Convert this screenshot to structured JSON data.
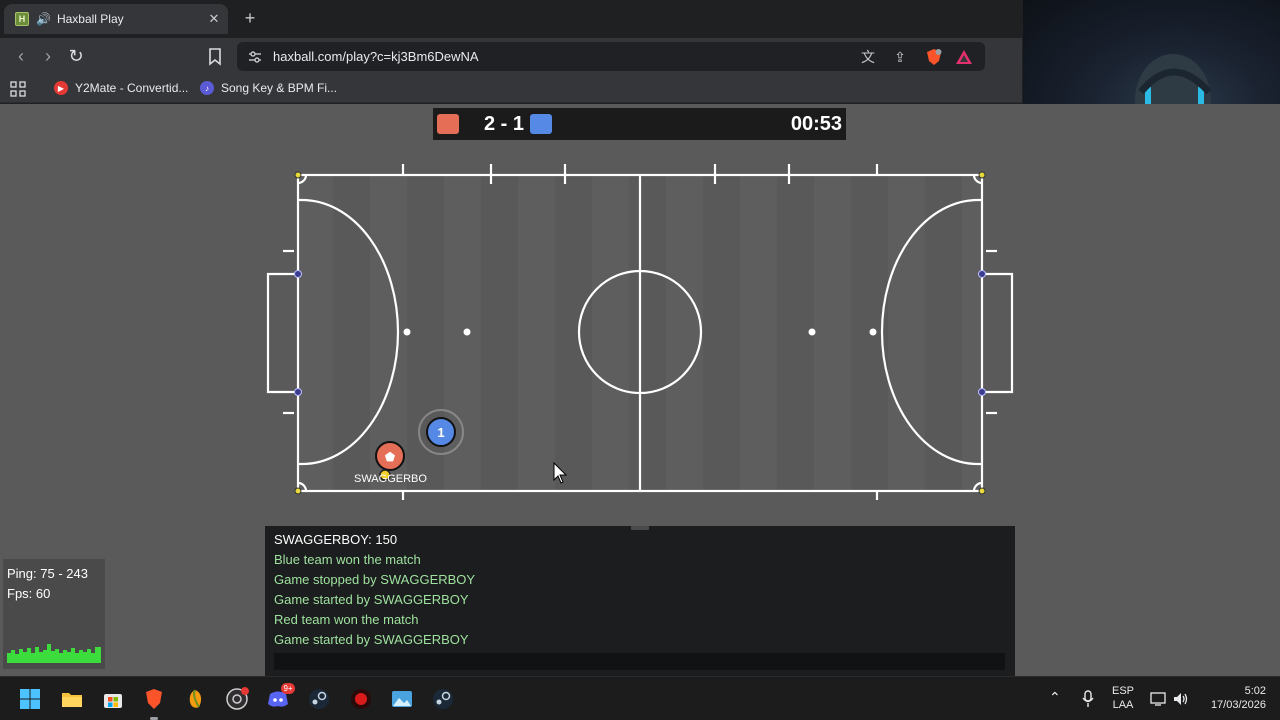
{
  "browser": {
    "tab": {
      "title": "Haxball Play",
      "favicon": "H",
      "icons": [
        "speaker-icon",
        "close-icon"
      ]
    },
    "new_tab_label": "+",
    "url": "haxball.com/play?c=kj3Bm6DewNA",
    "bookmarks": [
      {
        "label": "Y2Mate - Convertid...",
        "icon": "y2mate-icon",
        "color": "#e53935"
      },
      {
        "label": "Song Key & BPM Fi...",
        "icon": "song-key-icon",
        "color": "#5b5bd6"
      }
    ]
  },
  "scoreboard": {
    "score": "2 - 1",
    "time": "00:53",
    "red_color": "#e56e56",
    "blue_color": "#5689e5"
  },
  "players": [
    {
      "name": "SWAGGERBO",
      "team": "red",
      "avatar": "⬟"
    },
    {
      "name": "",
      "team": "blue",
      "avatar": "1"
    }
  ],
  "chat": {
    "lines": [
      {
        "text": "SWAGGERBOY: 150",
        "kind": "player"
      },
      {
        "text": "Blue team won the match",
        "kind": "system"
      },
      {
        "text": "Game stopped by SWAGGERBOY",
        "kind": "system"
      },
      {
        "text": "Game started by SWAGGERBOY",
        "kind": "system"
      },
      {
        "text": "Red team won the match",
        "kind": "system"
      },
      {
        "text": "Game started by SWAGGERBOY",
        "kind": "system"
      }
    ],
    "input_value": ""
  },
  "netstats": {
    "ping": "Ping: 75 - 243",
    "fps": "Fps: 60"
  },
  "taskbar": {
    "apps": [
      "windows-start-icon",
      "file-explorer-icon",
      "microsoft-store-icon",
      "brave-icon",
      "fl-studio-icon",
      "obs-icon",
      "discord-icon",
      "steam-icon",
      "red-app-icon",
      "photos-icon",
      "steam-icon-2"
    ],
    "discord_badge": "9+",
    "language_top": "ESP",
    "language_bottom": "LAA",
    "time": "5:02",
    "date": "17/03/2026"
  }
}
